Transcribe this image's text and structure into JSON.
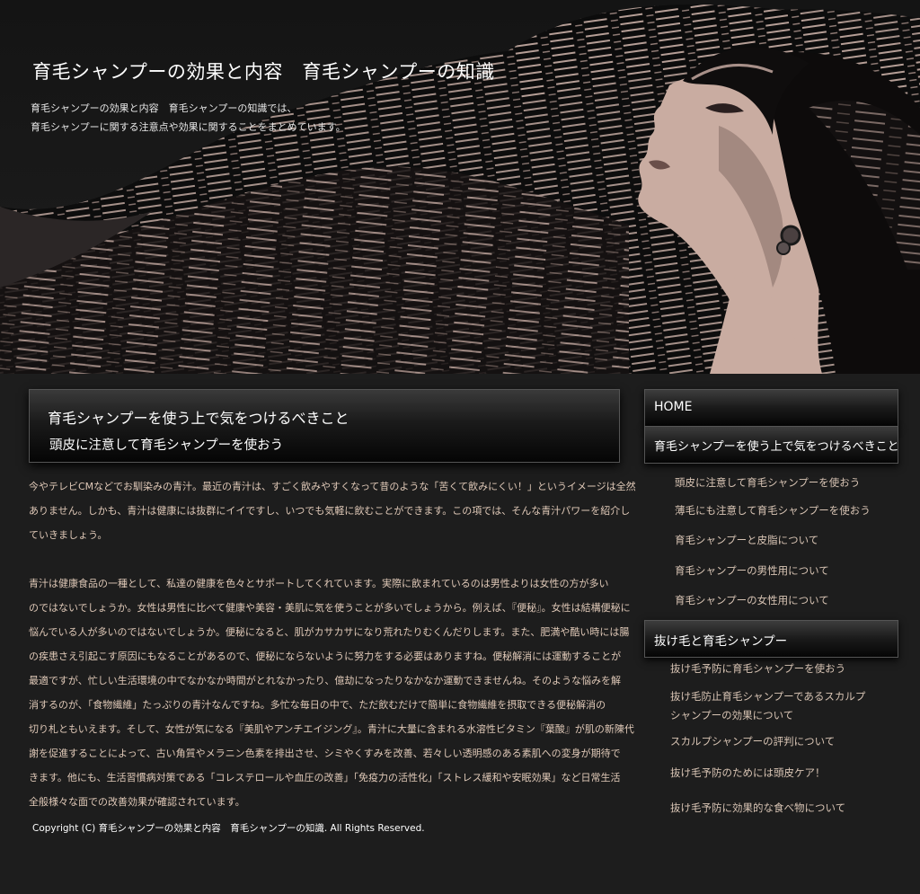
{
  "header": {
    "title": "育毛シャンプーの効果と内容　育毛シャンプーの知識",
    "description_lines": [
      "育毛シャンプーの効果と内容　育毛シャンプーの知識では、",
      "育毛シャンプーに関する注意点や効果に関することをまとめています。"
    ]
  },
  "main": {
    "heading": "育毛シャンプーを使う上で気をつけるべきこと",
    "subheading": "頭皮に注意して育毛シャンプーを使おう",
    "paragraphs": [
      [
        "今やテレビCMなどでお馴染みの青汁。最近の青汁は、すごく飲みやすくなって昔のような「苦くて飲みにくい！」というイメージは全然",
        "ありません。しかも、青汁は健康には抜群にイイですし、いつでも気軽に飲むことができます。この項では、そんな青汁パワーを紹介し",
        "ていきましょう。"
      ],
      [
        "青汁は健康食品の一種として、私達の健康を色々とサポートしてくれています。実際に飲まれているのは男性よりは女性の方が多い",
        "のではないでしょうか。女性は男性に比べて健康や美容・美肌に気を使うことが多いでしょうから。例えば、『便秘』。女性は結構便秘に",
        "悩んでいる人が多いのではないでしょうか。便秘になると、肌がカサカサになり荒れたりむくんだりします。また、肥満や酷い時には腸",
        "の疾患さえ引起こす原因にもなることがあるので、便秘にならないように努力をする必要はありますね。便秘解消には運動することが",
        "最適ですが、忙しい生活環境の中でなかなか時間がとれなかったり、億劫になったりなかなか運動できませんね。そのような悩みを解",
        "消するのが、「食物繊維」たっぷりの青汁なんですね。多忙な毎日の中で、ただ飲むだけで簡単に食物繊維を摂取できる便秘解消の",
        "切り札ともいえます。そして、女性が気になる『美肌やアンチエイジング』。青汁に大量に含まれる水溶性ビタミン『葉酸』が肌の新陳代",
        "謝を促進することによって、古い角質やメラニン色素を排出させ、シミやくすみを改善、若々しい透明感のある素肌への変身が期待で",
        "きます。他にも、生活習慣病対策である「コレステロールや血圧の改善」「免疫力の活性化」「ストレス緩和や安眠効果」など日常生活",
        "全般様々な面での改善効果が確認されています。"
      ]
    ]
  },
  "footer": {
    "copyright": "Copyright (C)  育毛シャンプーの効果と内容　育毛シャンプーの知識.  All Rights Reserved."
  },
  "sidebar": {
    "home": "HOME",
    "category1": {
      "title": "育毛シャンプーを使う上で気をつけるべきこと",
      "links": [
        "頭皮に注意して育毛シャンプーを使おう",
        "薄毛にも注意して育毛シャンプーを使おう",
        "育毛シャンプーと皮脂について",
        "育毛シャンプーの男性用について",
        "育毛シャンプーの女性用について"
      ]
    },
    "category2": {
      "title": "抜け毛と育毛シャンプー",
      "links": [
        "抜け毛予防に育毛シャンプーを使おう",
        "抜け毛防止育毛シャンプーであるスカルプ",
        "シャンプーの効果について",
        "スカルプシャンプーの評判について",
        "抜け毛予防のためには頭皮ケア！",
        "抜け毛予防に効果的な食べ物について"
      ]
    }
  },
  "colors": {
    "background": "#1d1d1d",
    "body_text": "#e0c9b8",
    "skin": "#c9aca1",
    "link_text": "#d8c4b4"
  }
}
